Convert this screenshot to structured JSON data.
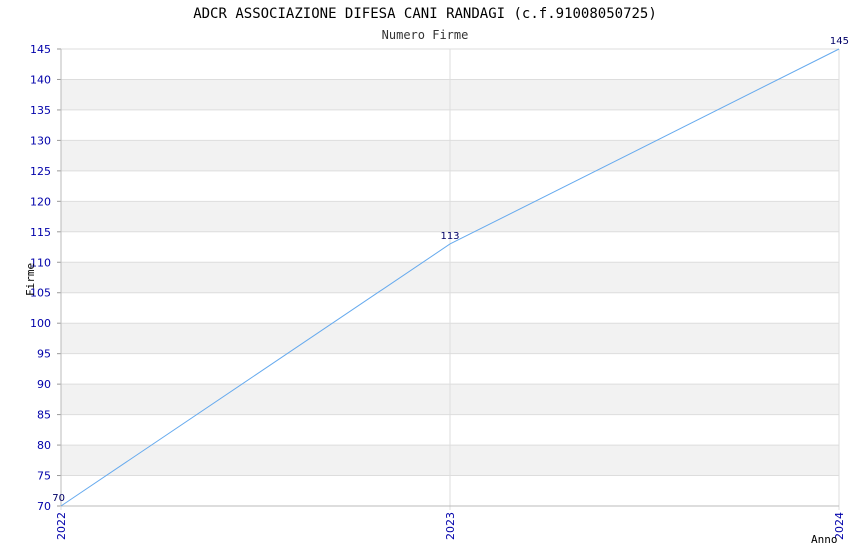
{
  "chart_data": {
    "type": "line",
    "title": "ADCR ASSOCIAZIONE DIFESA CANI RANDAGI (c.f.91008050725)",
    "subtitle": "Numero Firme",
    "xlabel": "Anno",
    "ylabel": "Firme",
    "categories": [
      "2022",
      "2023",
      "2024"
    ],
    "values": [
      70,
      113,
      145
    ],
    "data_labels": [
      "70",
      "113",
      "145"
    ],
    "ylim": [
      70,
      145
    ],
    "yticks": [
      70,
      75,
      80,
      85,
      90,
      95,
      100,
      105,
      110,
      115,
      120,
      125,
      130,
      135,
      140,
      145
    ],
    "grid": true,
    "legend": "none",
    "colors": {
      "line": "#66aaee",
      "band": "#f2f2f2",
      "grid": "#dddddd",
      "tick_text": "#0000aa"
    }
  }
}
